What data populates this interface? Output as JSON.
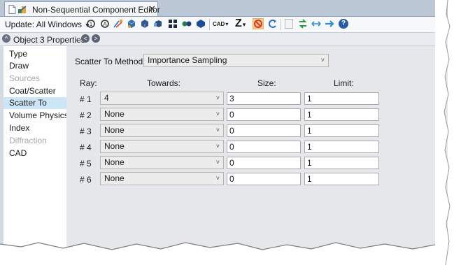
{
  "tab": {
    "title": "Non-Sequential Component Editor",
    "close": "✕"
  },
  "toolbar": {
    "update_label": "Update: All Windows",
    "dropdown_glyph": "▾",
    "icons": [
      "refresh-icon",
      "refresh-all-icon",
      "ray-trace-icon",
      "shaded-model-icon",
      "solid-model-icon",
      "3d-layout-icon",
      "grid-icon",
      "lens-icon",
      "object-icon",
      "cad-icon",
      "z-icon",
      "no-entry-icon",
      "undo-icon",
      "blank-icon",
      "swap-icon",
      "arrows-icon",
      "arrow-right-icon",
      "help-icon"
    ],
    "cad_label": "CAD",
    "z_label": "Z",
    "help_glyph": "?"
  },
  "props_header": {
    "title": "Object 3 Properties",
    "collapse_glyph": "^",
    "prev_glyph": "<",
    "next_glyph": ">"
  },
  "nav": {
    "items": [
      {
        "label": "Type",
        "state": "normal"
      },
      {
        "label": "Draw",
        "state": "normal"
      },
      {
        "label": "Sources",
        "state": "disabled"
      },
      {
        "label": "Coat/Scatter",
        "state": "normal"
      },
      {
        "label": "Scatter To",
        "state": "selected"
      },
      {
        "label": "Volume Physics",
        "state": "normal"
      },
      {
        "label": "Index",
        "state": "normal"
      },
      {
        "label": "Diffraction",
        "state": "disabled"
      },
      {
        "label": "CAD",
        "state": "normal"
      }
    ]
  },
  "scatter": {
    "method_label": "Scatter To Method:",
    "method_value": "Importance Sampling",
    "col_ray": "Ray:",
    "col_towards": "Towards:",
    "col_size": "Size:",
    "col_limit": "Limit:",
    "rows": [
      {
        "ray": "# 1",
        "towards": "4",
        "size": "3",
        "limit": "1"
      },
      {
        "ray": "# 2",
        "towards": "None",
        "size": "0",
        "limit": "1"
      },
      {
        "ray": "# 3",
        "towards": "None",
        "size": "0",
        "limit": "1"
      },
      {
        "ray": "# 4",
        "towards": "None",
        "size": "0",
        "limit": "1"
      },
      {
        "ray": "# 5",
        "towards": "None",
        "size": "0",
        "limit": "1"
      },
      {
        "ray": "# 6",
        "towards": "None",
        "size": "0",
        "limit": "1"
      }
    ],
    "dropdown_glyph": "˅"
  },
  "colors": {
    "selected_nav": "#cde6f7",
    "panel_bg": "#e5e7ea",
    "tab_strip": "#bcc7d6"
  }
}
